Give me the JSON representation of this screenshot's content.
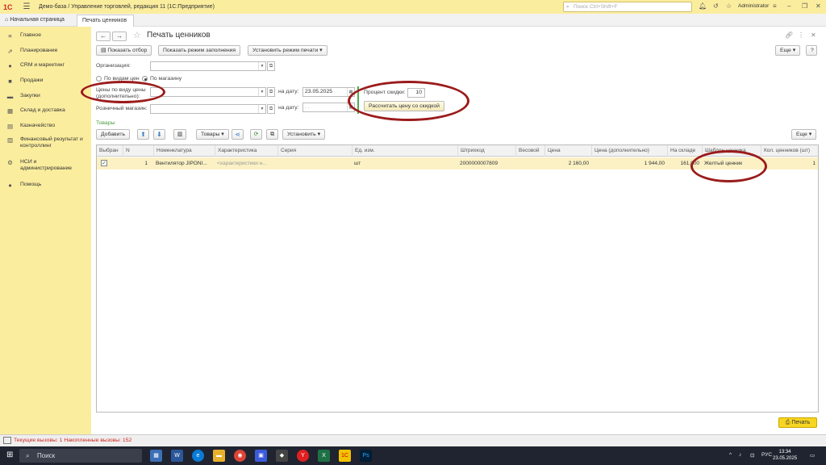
{
  "titlebar": {
    "logo": "1С",
    "title": "Демо-база / Управление торговлей, редакция 11  (1С:Предприятие)",
    "search_placeholder": "Поиск Ctrl+Shift+F",
    "user": "Administrator"
  },
  "tabs": {
    "home": "Начальная страница",
    "active": "Печать ценников",
    "close": "×"
  },
  "sidebar": {
    "items": [
      {
        "label": "Главное",
        "icon": "menu-icon"
      },
      {
        "label": "Планирование",
        "icon": "chart-icon"
      },
      {
        "label": "CRM и маркетинг",
        "icon": "crm-icon"
      },
      {
        "label": "Продажи",
        "icon": "sales-icon"
      },
      {
        "label": "Закупки",
        "icon": "truck-icon"
      },
      {
        "label": "Склад и доставка",
        "icon": "warehouse-icon"
      },
      {
        "label": "Казначейство",
        "icon": "treasury-icon"
      },
      {
        "label": "Финансовый результат и контроллинг",
        "icon": "finance-icon"
      },
      {
        "label": "НСИ и администрирование",
        "icon": "gear-icon"
      },
      {
        "label": "Помощь",
        "icon": "help-icon"
      }
    ]
  },
  "form": {
    "title": "Печать ценников",
    "toolbar": {
      "show_filter": "Показать отбор",
      "show_fill_mode": "Показать режим заполнения",
      "set_print_mode": "Установить режим печати",
      "more": "Еще",
      "help": "?"
    },
    "organization_label": "Организация:",
    "organization_value": "",
    "mode_option_1": "По видам цен",
    "mode_option_2": "По магазину",
    "price_type_label": "Цены по виду цены (дополнительно):",
    "price_type_value": "",
    "date_label_1": "на дату:",
    "date_value_1": "23.05.2025",
    "retail_store_label": "Розничный магазин:",
    "retail_store_value": "",
    "date_label_2": "на дату:",
    "date_value_2": ". .",
    "discount_label": "Процент скидки:",
    "discount_value": "10",
    "calc_button": "Рассчитать цену со скидкой",
    "goods_section": "Товары",
    "goods_toolbar": {
      "add": "Добавить",
      "goods": "Товары",
      "set": "Установить",
      "more": "Еще"
    },
    "table": {
      "columns": [
        "Выбран",
        "N",
        "Номенклатура",
        "Характеристика",
        "Серия",
        "Ед. изм.",
        "Штрихкод",
        "Весовой",
        "Цена",
        "Цена (дополнительно)",
        "На складе",
        "Шаблон ценника",
        "Кол. ценников (шт)"
      ],
      "rows": [
        {
          "selected": true,
          "n": "1",
          "item": "Вентилятор JIPONI...",
          "characteristic": "<характеристики н...",
          "series": "",
          "unit": "шт",
          "barcode": "2000000007809",
          "weighted": "",
          "price": "2 160,00",
          "price_extra": "1 944,00",
          "stock": "161,000",
          "template": "Желтый ценник",
          "count": "1"
        }
      ]
    },
    "print_button": "Печать"
  },
  "statusbar": {
    "text": "Текущие вызовы: 1   Накопленные вызовы: 152"
  },
  "taskbar": {
    "search": "Поиск",
    "lang": "РУС",
    "time": "13:34",
    "date": "23.05.2025"
  },
  "colors": {
    "sidebar_bg": "#fbed9e",
    "selected_row": "#fbf1c4",
    "annotation": "#9b1b1b",
    "print_button": "#f7d520"
  }
}
